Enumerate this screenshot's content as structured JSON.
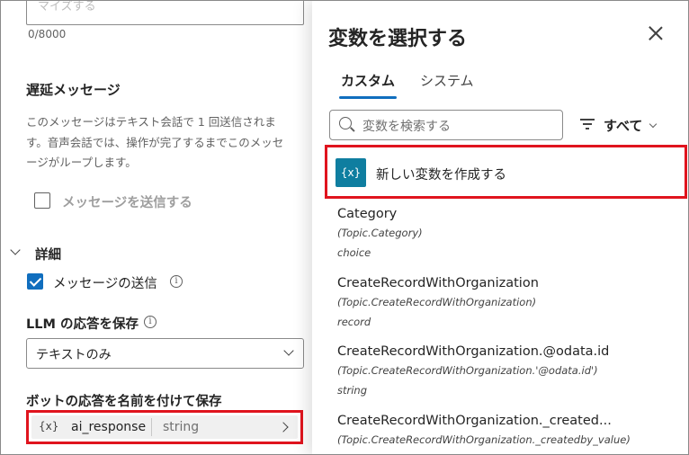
{
  "left": {
    "input_placeholder": "マイズする",
    "counter": "0/8000",
    "delay_message": {
      "title": "遅延メッセージ",
      "description_lines": [
        "このメッセージはテキスト会話で 1 回送信されま",
        "す。音声会話では、操作が完了するまでこのメッセ",
        "ージがループします。"
      ],
      "send_checkbox_label": "メッセージを送信する"
    },
    "details": {
      "title": "詳細",
      "send_message_label": "メッセージの送信",
      "llm_save_label": "LLM の応答を保存",
      "llm_save_value": "テキストのみ",
      "bot_save_label": "ボットの応答を名前を付けて保存",
      "variable": {
        "icon_text": "{x}",
        "name": "ai_response",
        "type": "string"
      }
    }
  },
  "panel": {
    "title": "変数を選択する",
    "tabs": [
      {
        "label": "カスタム",
        "active": true
      },
      {
        "label": "システム",
        "active": false
      }
    ],
    "search_placeholder": "変数を検索する",
    "filter_label": "すべて",
    "create_icon_text": "{x}",
    "create_label": "新しい変数を作成する",
    "variables": [
      {
        "name": "Category",
        "path": "(Topic.Category)",
        "type": "choice"
      },
      {
        "name": "CreateRecordWithOrganization",
        "path": "(Topic.CreateRecordWithOrganization)",
        "type": "record"
      },
      {
        "name": "CreateRecordWithOrganization.@odata.id",
        "path": "(Topic.CreateRecordWithOrganization.'@odata.id')",
        "type": "string"
      },
      {
        "name": "CreateRecordWithOrganization._created...",
        "path": "(Topic.CreateRecordWithOrganization._createdby_value)",
        "type": ""
      }
    ]
  },
  "colors": {
    "accent": "#106ebe",
    "highlight_border": "#e0141e",
    "variable_icon_bg": "#0f7ea0"
  }
}
